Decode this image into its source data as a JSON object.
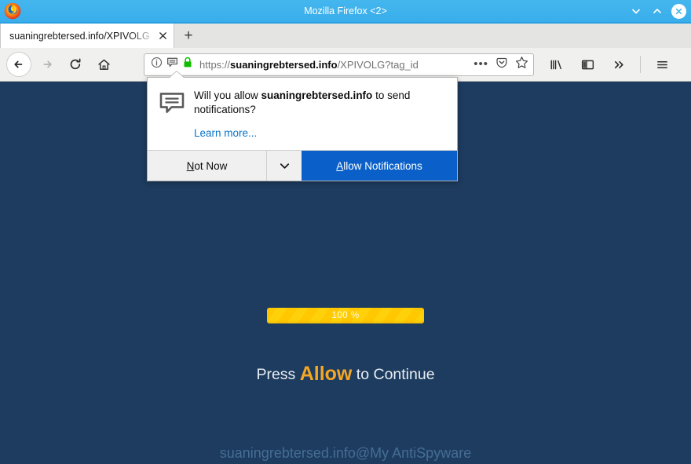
{
  "window": {
    "title": "Mozilla Firefox <2>",
    "controls": {
      "minimize": "⌄",
      "maximize": "⌃",
      "close": "✕"
    }
  },
  "tabs": {
    "items": [
      {
        "label": "suaningrebtersed.info/XPIVOLG",
        "close": "✕"
      }
    ],
    "new_tab": "+"
  },
  "navbar": {
    "back": "←",
    "forward": "→",
    "reload": "↻",
    "home": "⌂"
  },
  "urlbar": {
    "scheme": "https://",
    "host": "suaningrebtersed.info",
    "path": "/XPIVOLG?tag_id",
    "page_actions": "•••",
    "icons": {
      "identity": "info-icon",
      "permission": "notification-bubble-icon",
      "lock": "padlock-icon",
      "pocket": "pocket-icon",
      "bookmark": "star-icon"
    }
  },
  "toolbar": {
    "library": "library-icon",
    "sidebar": "sidebar-icon",
    "overflow": "»",
    "menu": "≡"
  },
  "popup": {
    "icon": "notification-bubble-icon",
    "question_prefix": "Will you allow ",
    "question_host": "suaningrebtersed.info",
    "question_suffix": " to send notifications?",
    "learn_more": "Learn more...",
    "not_now": "Not Now",
    "not_now_accesskey": "N",
    "dropdown": "⌄",
    "allow": "Allow Notifications",
    "allow_accesskey": "A"
  },
  "page": {
    "progress_label": "100 %",
    "progress_percent": 100,
    "press_prefix": "Press ",
    "press_allow": "Allow",
    "press_suffix": " to Continue",
    "watermark": "suaningrebtersed.info@My AntiSpyware"
  },
  "colors": {
    "page_background": "#1e3c5f",
    "titlebar": "#3fb2ec",
    "accent_orange": "#f5a623",
    "progress_yellow": "#ffcc00",
    "allow_button_blue": "#0a60c8",
    "link_blue": "#0a74c8",
    "watermark": "#456d94"
  }
}
